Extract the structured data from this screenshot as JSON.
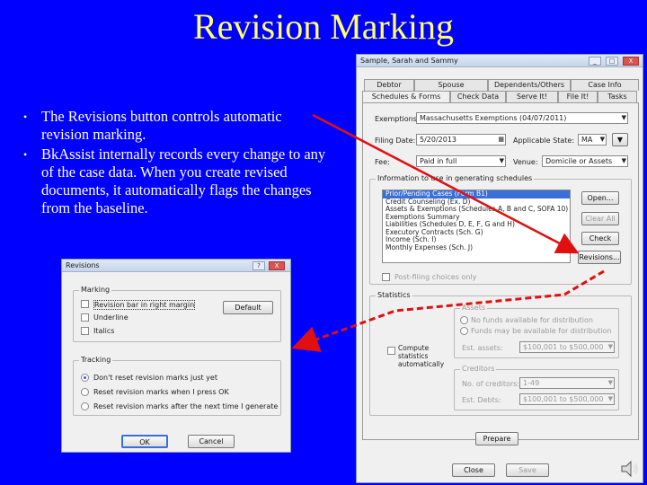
{
  "slide": {
    "title": "Revision Marking",
    "bullets": [
      "The Revisions button controls automatic revision marking.",
      "BkAssist internally records every change to any of the case data. When you create revised documents, it automatically flags the changes from the baseline."
    ]
  },
  "revisions_dialog": {
    "title": "Revisions",
    "help_btn": "?",
    "close_btn": "X",
    "marking": {
      "label": "Marking",
      "options": [
        "Revision bar in right margin",
        "Underline",
        "Italics"
      ],
      "default_button": "Default"
    },
    "tracking": {
      "label": "Tracking",
      "options": [
        "Don't reset revision marks just yet",
        "Reset revision marks when I press OK",
        "Reset revision marks after the next time I generate forms"
      ]
    },
    "ok_button": "OK",
    "cancel_button": "Cancel"
  },
  "case_window": {
    "title": "Sample, Sarah and Sammy",
    "controls": [
      "_",
      "□",
      "X"
    ],
    "tabs_row1": [
      "Debtor",
      "Spouse",
      "Dependents/Others",
      "Case Info"
    ],
    "tabs_row2": [
      "Schedules & Forms",
      "Check Data",
      "Serve It!",
      "File It!",
      "Tasks"
    ],
    "fields": {
      "exemptions_label": "Exemptions:",
      "exemptions_value": "Massachusetts Exemptions (04/07/2011)",
      "filing_date_label": "Filing Date:",
      "filing_date_value": "5/20/2013",
      "applicable_state_label": "Applicable State:",
      "applicable_state_value": "MA",
      "fee_label": "Fee:",
      "fee_value": "Paid in full",
      "venue_label": "Venue:",
      "venue_value": "Domicile or Assets"
    },
    "schedules": {
      "label": "Information to use in generating schedules",
      "items": [
        "Prior/Pending Cases (Form B1)",
        "Credit Counseling (Ex. D)",
        "Assets & Exemptions (Schedules A, B and C, SOFA 10)",
        "Exemptions Summary",
        "Liabilities (Schedules D, E, F, G and H)",
        "Executory Contracts (Sch. G)",
        "Income (Sch. I)",
        "Monthly Expenses (Sch. J)"
      ],
      "buttons": [
        "Open...",
        "Clear All",
        "Check",
        "Revisions..."
      ],
      "post_filing": "Post-filing choices only"
    },
    "statistics": {
      "label": "Statistics",
      "compute_auto": "Compute statistics automatically",
      "assets_label": "Assets",
      "assets_options": [
        "No funds available for distribution",
        "Funds may be available for distribution"
      ],
      "est_assets_label": "Est. assets:",
      "est_assets_value": "$100,001 to $500,000",
      "creditors_label": "Creditors",
      "num_creditors_label": "No. of creditors:",
      "num_creditors_value": "1-49",
      "est_debts_label": "Est. Debts:",
      "est_debts_value": "$100,001 to $500,000",
      "prepare_button": "Prepare"
    },
    "close_button": "Close",
    "save_button": "Save"
  },
  "colors": {
    "background": "#0000ff",
    "title": "#ffff66",
    "bullet_text": "#ffffff",
    "arrow": "#e01010"
  }
}
